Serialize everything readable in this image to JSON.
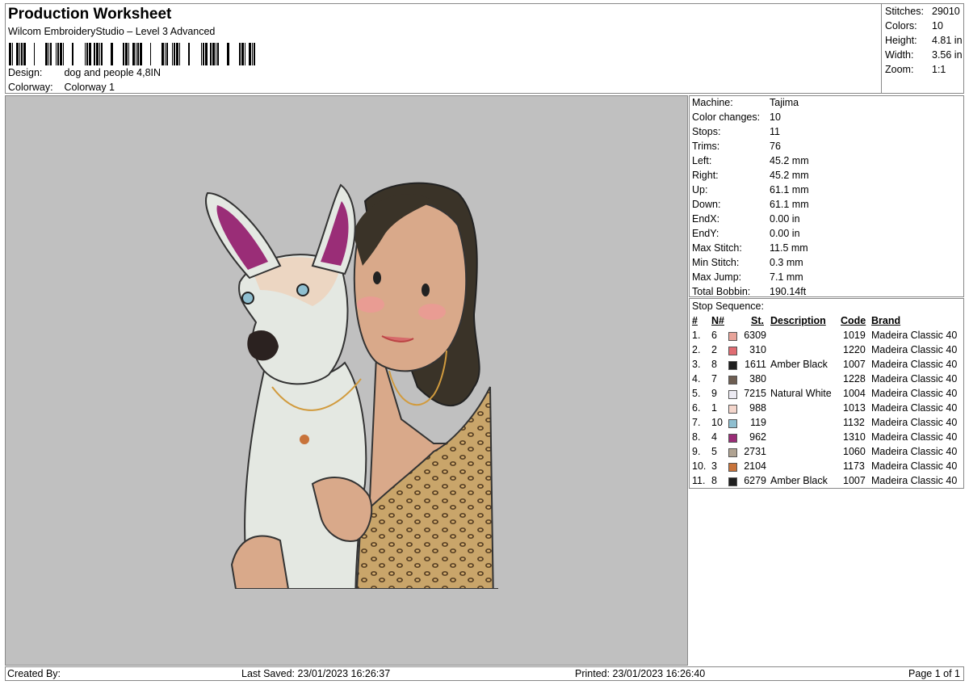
{
  "header": {
    "title": "Production Worksheet",
    "subtitle": "Wilcom EmbroideryStudio – Level 3 Advanced",
    "design_label": "Design:",
    "design_value": "dog and people 4,8IN",
    "colorway_label": "Colorway:",
    "colorway_value": "Colorway 1"
  },
  "stats": [
    {
      "label": "Stitches:",
      "value": "29010"
    },
    {
      "label": "Colors:",
      "value": "10"
    },
    {
      "label": "Height:",
      "value": "4.81 in"
    },
    {
      "label": "Width:",
      "value": "3.56 in"
    },
    {
      "label": "Zoom:",
      "value": "1:1"
    }
  ],
  "info": [
    {
      "label": "Machine:",
      "value": "Tajima"
    },
    {
      "label": "Color changes:",
      "value": "10"
    },
    {
      "label": "Stops:",
      "value": "11"
    },
    {
      "label": "Trims:",
      "value": "76"
    },
    {
      "label": "Left:",
      "value": "45.2 mm"
    },
    {
      "label": "Right:",
      "value": "45.2 mm"
    },
    {
      "label": "Up:",
      "value": "61.1 mm"
    },
    {
      "label": "Down:",
      "value": "61.1 mm"
    },
    {
      "label": "EndX:",
      "value": "0.00 in"
    },
    {
      "label": "EndY:",
      "value": "0.00 in"
    },
    {
      "label": "Max Stitch:",
      "value": "11.5 mm"
    },
    {
      "label": "Min Stitch:",
      "value": "0.3 mm"
    },
    {
      "label": "Max Jump:",
      "value": "7.1 mm"
    },
    {
      "label": "Total Bobbin:",
      "value": "190.14ft"
    }
  ],
  "sequence": {
    "title": "Stop Sequence:",
    "headers": {
      "num": "#",
      "n": "N#",
      "st": "St.",
      "desc": "Description",
      "code": "Code",
      "brand": "Brand"
    },
    "rows": [
      {
        "num": "1.",
        "n": "6",
        "color": "#e8a49a",
        "st": "6309",
        "desc": "",
        "code": "1019",
        "brand": "Madeira Classic 40"
      },
      {
        "num": "2.",
        "n": "2",
        "color": "#e06c72",
        "st": "310",
        "desc": "",
        "code": "1220",
        "brand": "Madeira Classic 40"
      },
      {
        "num": "3.",
        "n": "8",
        "color": "#1e1e1e",
        "st": "1611",
        "desc": "Amber Black",
        "code": "1007",
        "brand": "Madeira Classic 40"
      },
      {
        "num": "4.",
        "n": "7",
        "color": "#6e5e52",
        "st": "380",
        "desc": "",
        "code": "1228",
        "brand": "Madeira Classic 40"
      },
      {
        "num": "5.",
        "n": "9",
        "color": "#eceaf2",
        "st": "7215",
        "desc": "Natural White",
        "code": "1004",
        "brand": "Madeira Classic 40"
      },
      {
        "num": "6.",
        "n": "1",
        "color": "#f4d6cc",
        "st": "988",
        "desc": "",
        "code": "1013",
        "brand": "Madeira Classic 40"
      },
      {
        "num": "7.",
        "n": "10",
        "color": "#8fbfd0",
        "st": "119",
        "desc": "",
        "code": "1132",
        "brand": "Madeira Classic 40"
      },
      {
        "num": "8.",
        "n": "4",
        "color": "#9a2d77",
        "st": "962",
        "desc": "",
        "code": "1310",
        "brand": "Madeira Classic 40"
      },
      {
        "num": "9.",
        "n": "5",
        "color": "#b0a392",
        "st": "2731",
        "desc": "",
        "code": "1060",
        "brand": "Madeira Classic 40"
      },
      {
        "num": "10.",
        "n": "3",
        "color": "#c8733a",
        "st": "2104",
        "desc": "",
        "code": "1173",
        "brand": "Madeira Classic 40"
      },
      {
        "num": "11.",
        "n": "8",
        "color": "#1e1e1e",
        "st": "6279",
        "desc": "Amber Black",
        "code": "1007",
        "brand": "Madeira Classic 40"
      }
    ]
  },
  "footer": {
    "created": "Created By:",
    "saved": "Last Saved: 23/01/2023 16:26:37",
    "printed": "Printed: 23/01/2023 16:26:40",
    "page": "Page 1 of 1"
  }
}
